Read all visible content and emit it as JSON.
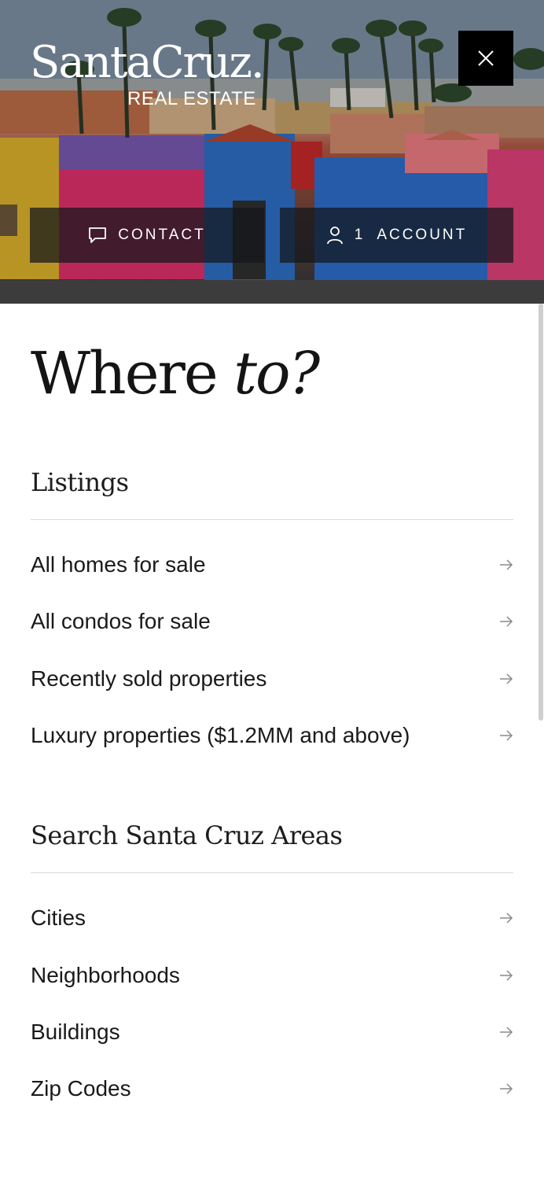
{
  "header": {
    "logo": {
      "main": "SantaCruz.",
      "sub": "REAL ESTATE"
    },
    "close_icon": "close-icon",
    "buttons": {
      "contact": {
        "icon": "chat-icon",
        "label": "CONTACT"
      },
      "account": {
        "icon": "user-icon",
        "count": "1",
        "label": "ACCOUNT"
      }
    }
  },
  "menu": {
    "headline": {
      "plain": "Where",
      "italic": "to?"
    },
    "sections": [
      {
        "title": "Listings",
        "items": [
          {
            "label": "All homes for sale"
          },
          {
            "label": "All condos for sale"
          },
          {
            "label": "Recently sold properties"
          },
          {
            "label": "Luxury properties ($1.2MM and above)"
          }
        ]
      },
      {
        "title": "Search Santa Cruz Areas",
        "items": [
          {
            "label": "Cities"
          },
          {
            "label": "Neighborhoods"
          },
          {
            "label": "Buildings"
          },
          {
            "label": "Zip Codes"
          }
        ]
      }
    ],
    "arrow_icon": "arrow-right-icon"
  },
  "colors": {
    "button_dark": "#000000",
    "text": "#1a1a1a",
    "divider": "#d9d9d9"
  }
}
